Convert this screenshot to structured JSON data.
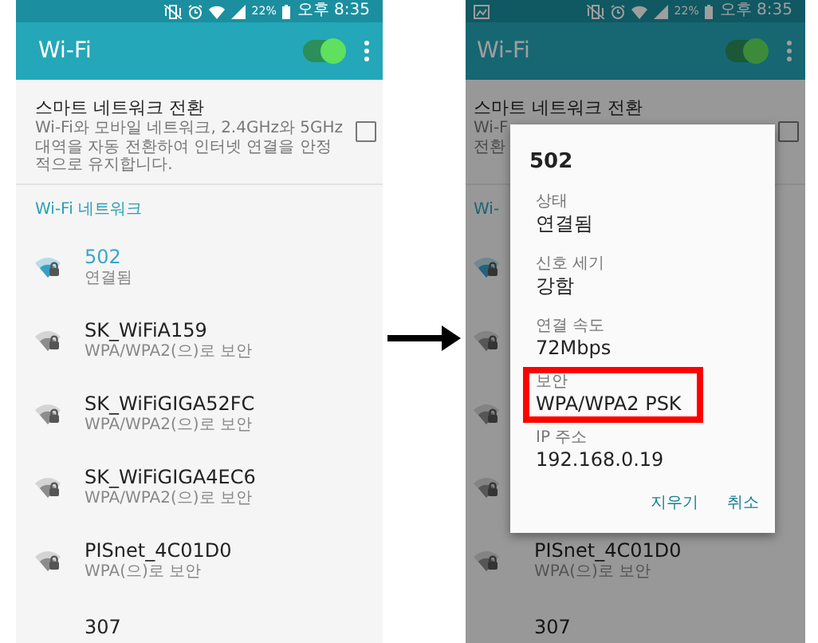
{
  "phones": [
    {
      "dimmed": false,
      "status_bar": {
        "gallery_notification": false,
        "battery": "22%",
        "time": "오후 8:35"
      },
      "app_bar": {
        "title": "Wi-Fi",
        "wifi_on": true
      },
      "smart_switch": {
        "title": "스마트 네트워크 전환",
        "description": "Wi-Fi와 모바일 네트워크, 2.4GHz와 5GHz 대역을 자동 전환하여 인터넷 연결을 안정적으로 유지합니다.",
        "checked": false
      },
      "section_header": "Wi-Fi 네트워크",
      "networks": [
        {
          "kind": "full",
          "name": "502",
          "detail": "연결됨",
          "connected": true
        },
        {
          "kind": "full",
          "name": "SK_WiFiA159",
          "detail": "WPA/WPA2(으)로 보안",
          "connected": false
        },
        {
          "kind": "full",
          "name": "SK_WiFiGIGA52FC",
          "detail": "WPA/WPA2(으)로 보안",
          "connected": false
        },
        {
          "kind": "full",
          "name": "SK_WiFiGIGA4EC6",
          "detail": "WPA/WPA2(으)로 보안",
          "connected": false
        },
        {
          "kind": "full",
          "name": "PISnet_4C01D0",
          "detail": "WPA(으)로 보안",
          "connected": false
        },
        {
          "kind": "name_only",
          "name": "307"
        }
      ]
    },
    {
      "dimmed": true,
      "status_bar": {
        "gallery_notification": true,
        "battery": "22%",
        "time": "오후 8:35"
      },
      "app_bar": {
        "title": "Wi-Fi",
        "wifi_on": true
      },
      "smart_switch": {
        "title": "스마트 네트워크 전환",
        "description_fragments": [
          "Wi-F",
          "전환"
        ],
        "checked": false
      },
      "section_header": "Wi-",
      "networks": [
        {
          "kind": "icon_only",
          "connected": true
        },
        {
          "kind": "icon_only",
          "connected": false
        },
        {
          "kind": "icon_only",
          "connected": false
        },
        {
          "kind": "icon_only",
          "connected": false
        },
        {
          "kind": "full",
          "name": "PISnet_4C01D0",
          "detail": "WPA(으)로 보안",
          "connected": false
        },
        {
          "kind": "name_only",
          "name": "307"
        }
      ],
      "dialog": {
        "title": "502",
        "fields": [
          {
            "label": "상태",
            "value": "연결됨",
            "highlighted": false
          },
          {
            "label": "신호 세기",
            "value": "강함",
            "highlighted": false
          },
          {
            "label": "연결 속도",
            "value": "72Mbps",
            "highlighted": false
          },
          {
            "label": "보안",
            "value": "WPA/WPA2 PSK",
            "highlighted": true
          },
          {
            "label": "IP 주소",
            "value": "192.168.0.19",
            "highlighted": false
          }
        ],
        "buttons": [
          "지우기",
          "취소"
        ]
      }
    }
  ]
}
